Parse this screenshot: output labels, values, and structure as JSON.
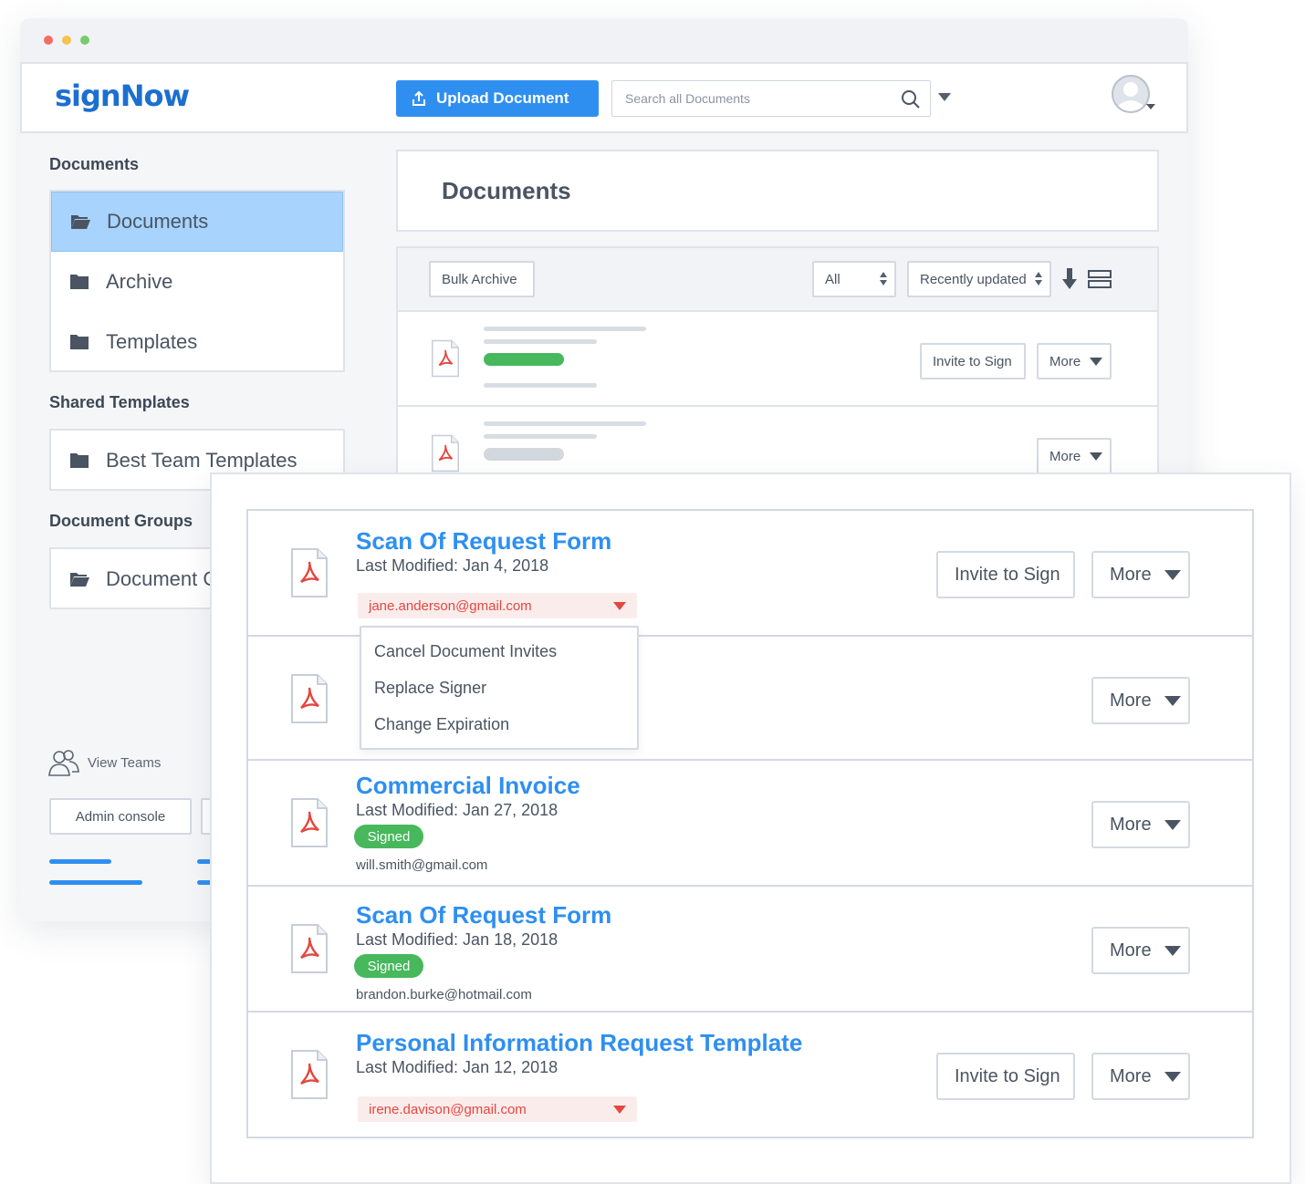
{
  "app": {
    "logo": "signNow",
    "upload_label": "Upload Document",
    "search_placeholder": "Search all Documents"
  },
  "sidebar": {
    "documents_heading": "Documents",
    "documents_items": [
      {
        "label": "Documents",
        "icon": "folder-open-icon",
        "active": true
      },
      {
        "label": "Archive",
        "icon": "folder-icon"
      },
      {
        "label": "Templates",
        "icon": "folder-icon"
      }
    ],
    "shared_heading": "Shared Templates",
    "shared_items": [
      {
        "label": "Best Team Templates",
        "icon": "folder-icon"
      }
    ],
    "groups_heading": "Document Groups",
    "groups_items": [
      {
        "label": "Document Groups",
        "icon": "folder-open-icon"
      }
    ],
    "view_teams": "View Teams",
    "admin_console": "Admin console"
  },
  "main": {
    "title": "Documents",
    "toolbar": {
      "bulk_archive": "Bulk Archive",
      "filter_value": "All",
      "sort_value": "Recently updated"
    },
    "back_rows": [
      {
        "invite_label": "Invite to Sign",
        "more_label": "More",
        "status_color": "#47b85c"
      },
      {
        "more_label": "More",
        "status_color": "#d3d8df"
      }
    ]
  },
  "documents": [
    {
      "title": "Scan Of Request Form",
      "modified": "Last Modified: Jan 4, 2018",
      "signer": "jane.anderson@gmail.com",
      "invite_label": "Invite to Sign",
      "more_label": "More"
    },
    {
      "more_label": "More"
    },
    {
      "title": "Commercial Invoice",
      "modified": "Last Modified: Jan 27, 2018",
      "status": "Signed",
      "email": "will.smith@gmail.com",
      "more_label": "More"
    },
    {
      "title": "Scan Of Request Form",
      "modified": "Last Modified: Jan 18, 2018",
      "status": "Signed",
      "email": "brandon.burke@hotmail.com",
      "more_label": "More"
    },
    {
      "title": "Personal Information Request Template",
      "modified": "Last Modified: Jan 12, 2018",
      "signer": "irene.davison@gmail.com",
      "invite_label": "Invite to Sign",
      "more_label": "More"
    }
  ],
  "signer_menu": {
    "items": [
      "Cancel Document Invites",
      "Replace Signer",
      "Change Expiration"
    ]
  },
  "colors": {
    "accent": "#2e8ff0",
    "signed_green": "#47b85c",
    "signer_red": "#e4473f",
    "active_folder": "#a7d3fd"
  }
}
